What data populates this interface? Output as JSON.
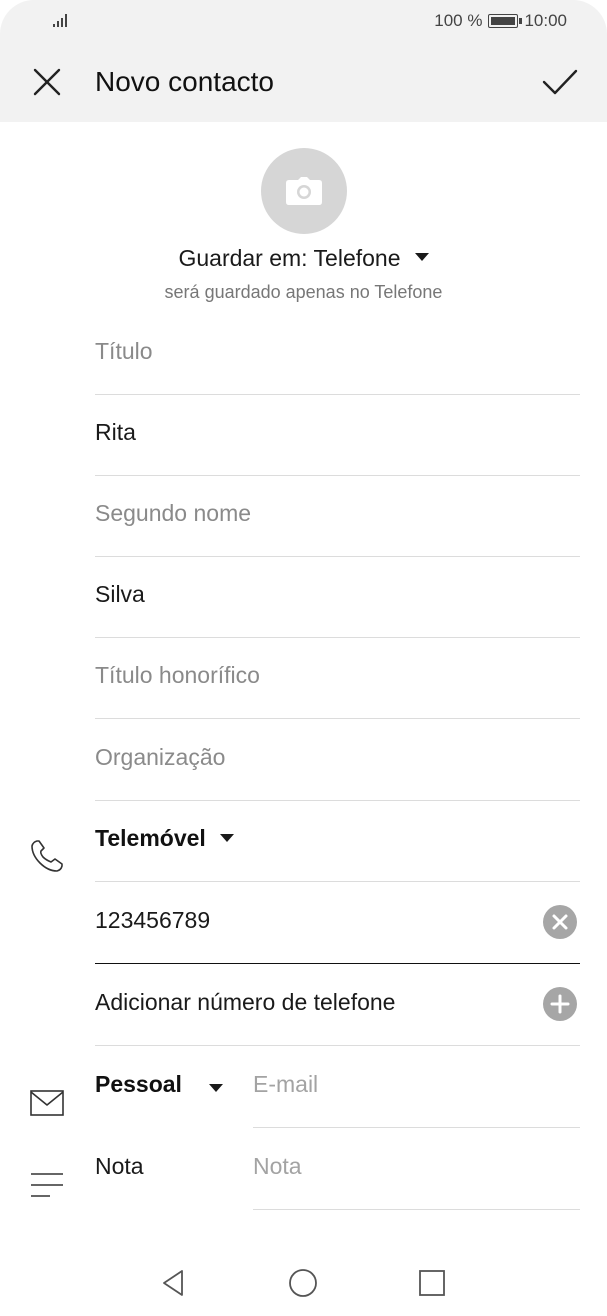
{
  "status_bar": {
    "battery": "100 %",
    "time": "10:00",
    "icons": [
      "signal-icon",
      "battery-icon"
    ]
  },
  "app_bar": {
    "title": "Novo contacto",
    "close_icon": "close-icon",
    "confirm_icon": "check-icon"
  },
  "photo": {
    "icon": "camera-icon"
  },
  "save_location": {
    "label": "Guardar em: Telefone",
    "note": "será guardado apenas no Telefone"
  },
  "fields": {
    "title_placeholder": "Título",
    "first_name": "Rita",
    "middle_name_placeholder": "Segundo nome",
    "last_name": "Silva",
    "suffix_placeholder": "Título honorífico",
    "organization_placeholder": "Organização"
  },
  "phone": {
    "type": "Telemóvel",
    "number": "123456789",
    "add_label": "Adicionar número de telefone"
  },
  "email": {
    "type": "Pessoal",
    "placeholder": "E-mail"
  },
  "note": {
    "label": "Nota",
    "placeholder": "Nota"
  },
  "colors": {
    "app_bar_bg": "#f2f2f2",
    "photo_bg": "#d6d6d6",
    "icon_grey": "#a6a6a6"
  }
}
